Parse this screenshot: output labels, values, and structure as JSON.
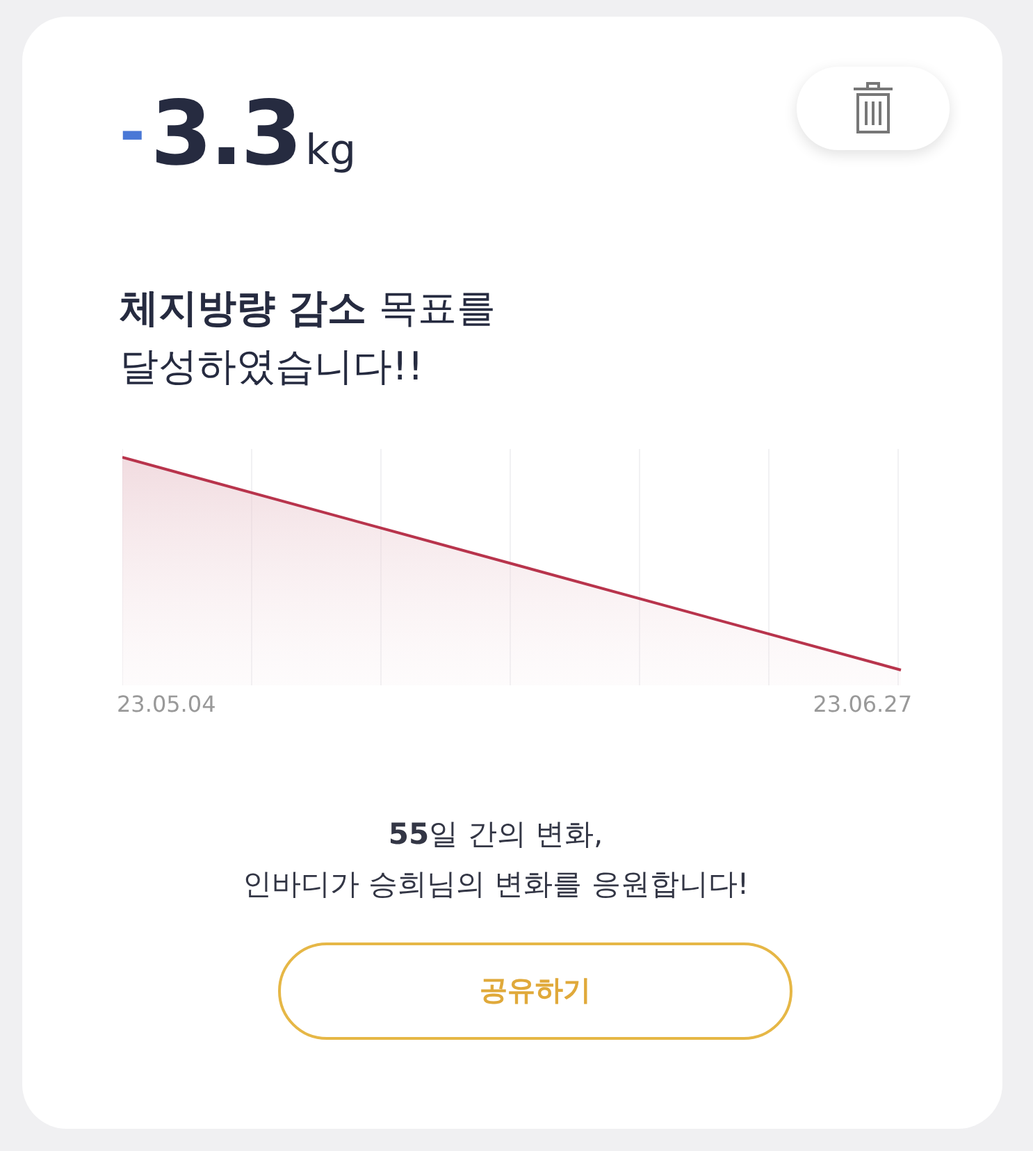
{
  "result": {
    "sign": "-",
    "value": "3.3",
    "unit": "kg"
  },
  "headline": [
    "**체지방량 감소** 목표를",
    "달성하였습니다!!"
  ],
  "chart": {
    "start_label": "23.05.04",
    "end_label": "23.06.27"
  },
  "message": [
    "**55**일 간의 변화,",
    "인바디가 승희님의 변화를 응원합니다!"
  ],
  "share_button": "공유하기"
}
